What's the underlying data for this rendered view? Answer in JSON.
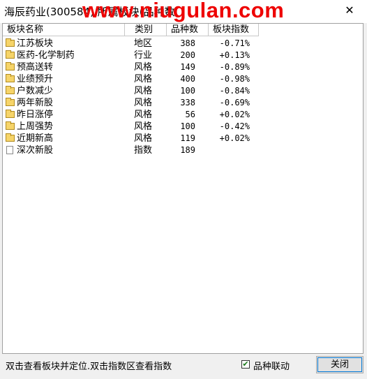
{
  "window": {
    "title": "海辰药业(300584) 所属板块(品种数",
    "watermark": "www.niugulan.com",
    "close_glyph": "✕"
  },
  "table": {
    "columns": [
      "板块名称",
      "类别",
      "品种数",
      "板块指数"
    ],
    "rows": [
      {
        "name": "江苏板块",
        "category": "地区",
        "count": "388",
        "index": "-0.71%",
        "icon": "folder-icon"
      },
      {
        "name": "医药-化学制药",
        "category": "行业",
        "count": "200",
        "index": "+0.13%",
        "icon": "folder-icon"
      },
      {
        "name": "预高送转",
        "category": "风格",
        "count": "149",
        "index": "-0.89%",
        "icon": "folder-icon"
      },
      {
        "name": "业绩预升",
        "category": "风格",
        "count": "400",
        "index": "-0.98%",
        "icon": "folder-icon"
      },
      {
        "name": "户数减少",
        "category": "风格",
        "count": "100",
        "index": "-0.84%",
        "icon": "folder-icon"
      },
      {
        "name": "两年新股",
        "category": "风格",
        "count": "338",
        "index": "-0.69%",
        "icon": "folder-icon"
      },
      {
        "name": "昨日涨停",
        "category": "风格",
        "count": "56",
        "index": "+0.02%",
        "icon": "folder-icon"
      },
      {
        "name": "上周强势",
        "category": "风格",
        "count": "100",
        "index": "-0.42%",
        "icon": "folder-icon"
      },
      {
        "name": "近期新高",
        "category": "风格",
        "count": "119",
        "index": "+0.02%",
        "icon": "folder-icon"
      },
      {
        "name": "深次新股",
        "category": "指数",
        "count": "189",
        "index": "",
        "icon": "page-icon"
      }
    ]
  },
  "footer": {
    "hint": "双击查看板块并定位.双击指数区查看指数",
    "checkbox_label": "品种联动",
    "checkbox_checked": true,
    "check_glyph": "✔",
    "close_label": "关闭"
  }
}
